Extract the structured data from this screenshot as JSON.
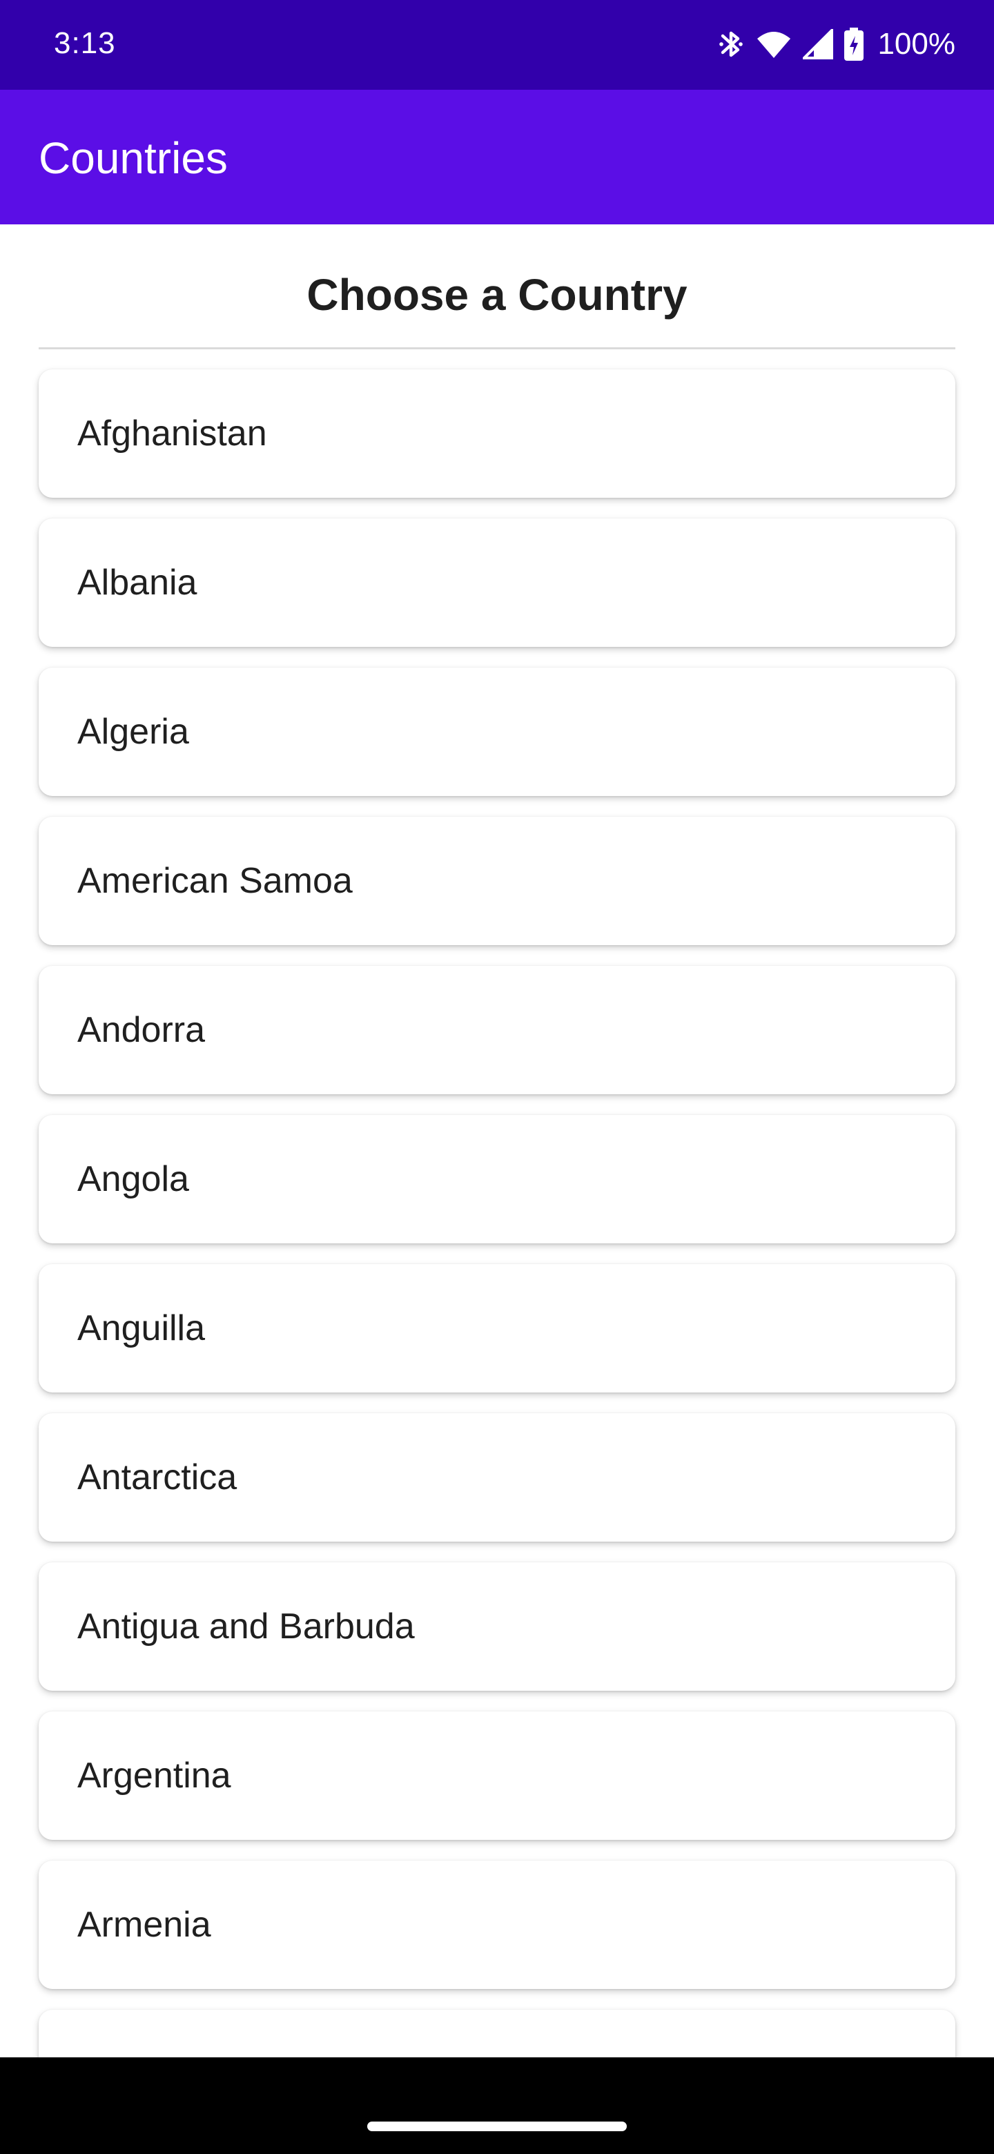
{
  "status_bar": {
    "time": "3:13",
    "battery": "100%",
    "icons": [
      "bluetooth-icon",
      "wifi-icon",
      "signal-icon",
      "battery-charging-icon"
    ]
  },
  "app_bar": {
    "title": "Countries",
    "color": "#5b0ee6"
  },
  "list": {
    "heading": "Choose a Country",
    "items": [
      "Afghanistan",
      "Albania",
      "Algeria",
      "American Samoa",
      "Andorra",
      "Angola",
      "Anguilla",
      "Antarctica",
      "Antigua and Barbuda",
      "Argentina",
      "Armenia",
      ""
    ]
  },
  "colors": {
    "status_bar": "#3200ab",
    "app_bar": "#5b0ee6",
    "text": "#1f1f1f"
  }
}
